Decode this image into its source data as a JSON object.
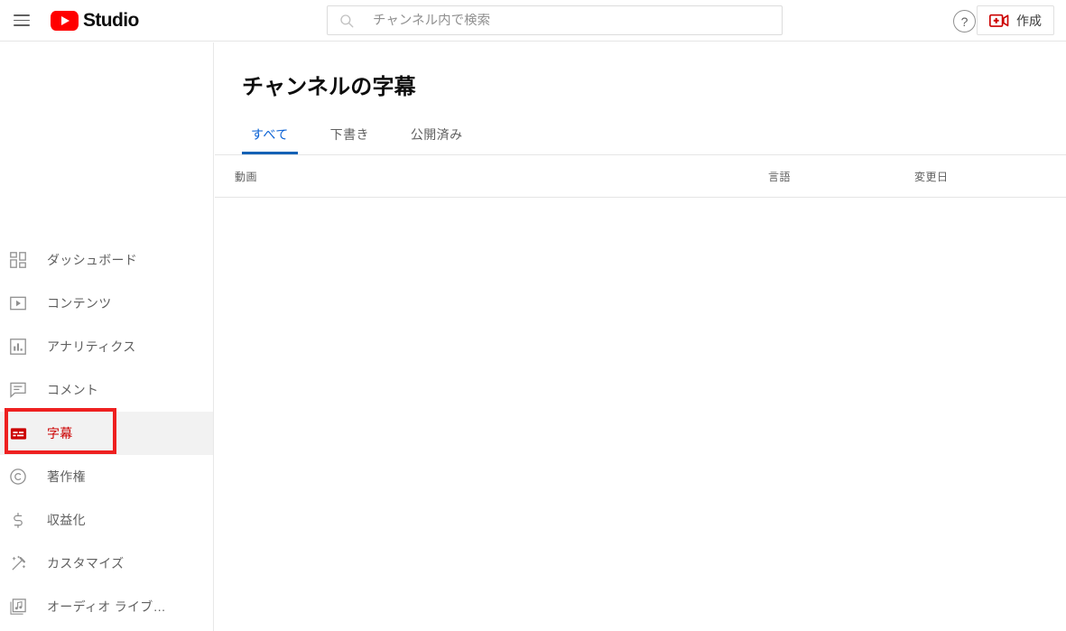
{
  "header": {
    "menu_icon": "hamburger-menu-icon",
    "brand": "Studio",
    "logo_icon": "youtube-logo-icon",
    "search": {
      "icon": "search-icon",
      "placeholder": "チャンネル内で検索",
      "value": ""
    },
    "help_label": "?",
    "create": {
      "label": "作成",
      "icon": "video-camera-plus-icon"
    }
  },
  "sidebar": {
    "items": [
      {
        "label": "ダッシュボード",
        "icon": "dashboard-grid-icon",
        "active": false
      },
      {
        "label": "コンテンツ",
        "icon": "content-play-box-icon",
        "active": false
      },
      {
        "label": "アナリティクス",
        "icon": "analytics-bar-chart-icon",
        "active": false
      },
      {
        "label": "コメント",
        "icon": "comment-bubble-icon",
        "active": false
      },
      {
        "label": "字幕",
        "icon": "subtitles-icon",
        "active": true
      },
      {
        "label": "著作権",
        "icon": "copyright-icon",
        "active": false
      },
      {
        "label": "収益化",
        "icon": "monetization-dollar-icon",
        "active": false
      },
      {
        "label": "カスタマイズ",
        "icon": "customization-wand-icon",
        "active": false
      },
      {
        "label": "オーディオ ライブ…",
        "icon": "audio-library-note-icon",
        "active": false
      }
    ]
  },
  "main": {
    "title": "チャンネルの字幕",
    "tabs": [
      {
        "label": "すべて",
        "active": true
      },
      {
        "label": "下書き",
        "active": false
      },
      {
        "label": "公開済み",
        "active": false
      }
    ],
    "table": {
      "columns": [
        "動画",
        "言語",
        "変更日"
      ],
      "rows": []
    }
  },
  "colors": {
    "brand_red": "#ff0000",
    "active_red": "#cc0000",
    "annotation_red": "#ee2020",
    "tab_blue": "#065fd4",
    "tab_underline": "#1462b5",
    "text_secondary": "#606060",
    "border": "#e5e5e5",
    "active_row_bg": "#f2f2f2"
  }
}
